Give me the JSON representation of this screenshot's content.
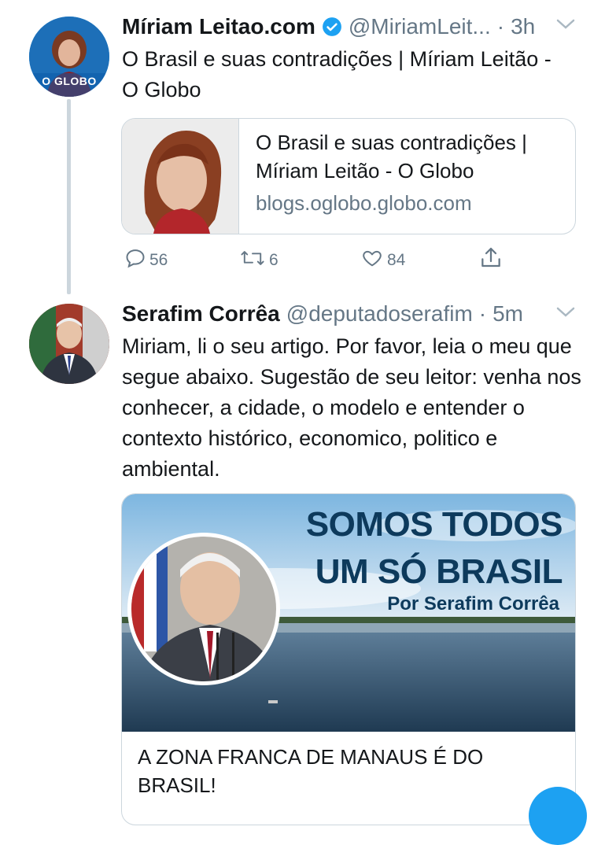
{
  "tweet1": {
    "display_name": "Míriam Leitao.com",
    "handle": "@MiriamLeit...",
    "separator": "·",
    "time": "3h",
    "avatar_badge": "O GLOBO",
    "text": "O Brasil e suas contradições | Míriam Leitão - O Globo",
    "card": {
      "title": "O Brasil e suas contradições | Míriam Leitão - O Globo",
      "domain": "blogs.oglobo.globo.com"
    },
    "actions": {
      "replies": "56",
      "retweets": "6",
      "likes": "84"
    }
  },
  "tweet2": {
    "display_name": "Serafim Corrêa",
    "handle": "@deputadoserafim",
    "separator": "·",
    "time": "5m",
    "text": "Miriam, li o seu artigo. Por favor, leia o meu que segue abaixo. Sugestão de seu leitor: venha nos conhecer, a cidade, o modelo e entender o contexto histórico, economico, politico e ambiental.",
    "card": {
      "banner_line1": "SOMOS TODOS",
      "banner_line2": "UM SÓ BRASIL",
      "banner_byline": "Por Serafim Corrêa",
      "title": "A ZONA FRANCA DE MANAUS É DO BRASIL!"
    }
  },
  "colors": {
    "accent": "#1da1f2",
    "secondary_text": "#657786",
    "border": "#ccd6dd",
    "banner_text": "#0d3a5c"
  }
}
